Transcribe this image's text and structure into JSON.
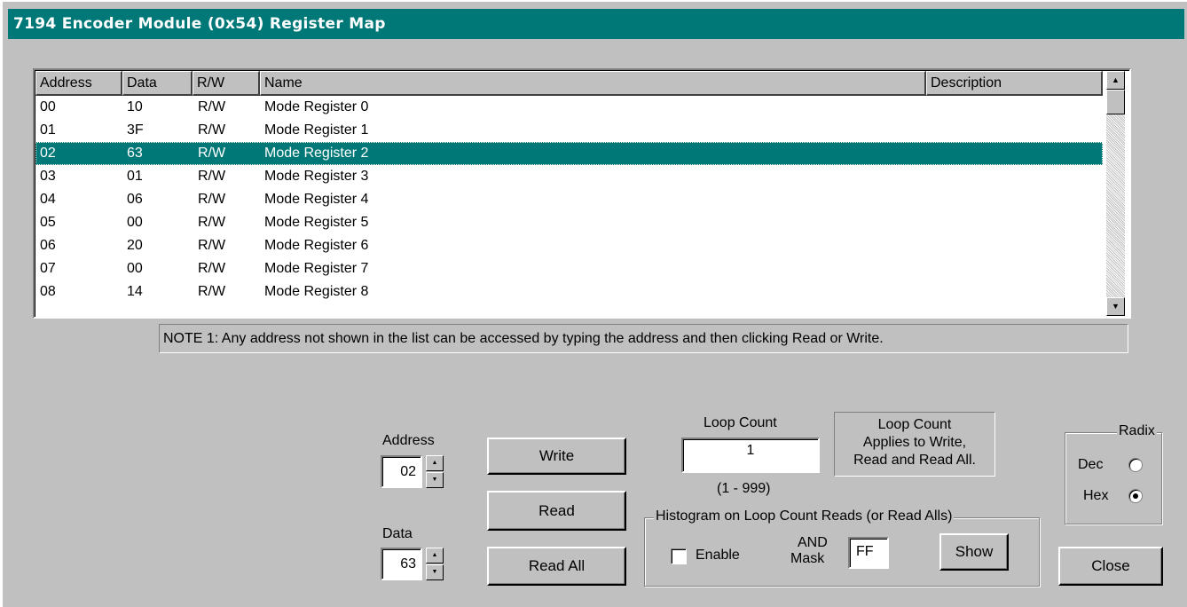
{
  "window": {
    "title": "7194 Encoder Module (0x54) Register Map"
  },
  "list": {
    "columns": [
      "Address",
      "Data",
      "R/W",
      "Name",
      "Description"
    ],
    "selected_index": 2,
    "rows": [
      {
        "address": "00",
        "data": "10",
        "rw": "R/W",
        "name": "Mode Register 0",
        "description": ""
      },
      {
        "address": "01",
        "data": "3F",
        "rw": "R/W",
        "name": "Mode Register 1",
        "description": ""
      },
      {
        "address": "02",
        "data": "63",
        "rw": "R/W",
        "name": "Mode Register 2",
        "description": ""
      },
      {
        "address": "03",
        "data": "01",
        "rw": "R/W",
        "name": "Mode Register 3",
        "description": ""
      },
      {
        "address": "04",
        "data": "06",
        "rw": "R/W",
        "name": "Mode Register 4",
        "description": ""
      },
      {
        "address": "05",
        "data": "00",
        "rw": "R/W",
        "name": "Mode Register 5",
        "description": ""
      },
      {
        "address": "06",
        "data": "20",
        "rw": "R/W",
        "name": "Mode Register 6",
        "description": ""
      },
      {
        "address": "07",
        "data": "00",
        "rw": "R/W",
        "name": "Mode Register 7",
        "description": ""
      },
      {
        "address": "08",
        "data": "14",
        "rw": "R/W",
        "name": "Mode Register 8",
        "description": ""
      }
    ]
  },
  "note": "NOTE 1: Any address not shown in the list can be accessed by typing the address and then clicking Read or Write.",
  "address": {
    "label": "Address",
    "value": "02"
  },
  "data": {
    "label": "Data",
    "value": "63"
  },
  "buttons": {
    "write": "Write",
    "read": "Read",
    "read_all": "Read All",
    "show": "Show",
    "close": "Close"
  },
  "loop": {
    "label": "Loop Count",
    "value": "1",
    "range": "(1 - 999)",
    "info_lines": [
      "Loop Count",
      "Applies to Write,",
      "Read and Read All."
    ]
  },
  "histogram": {
    "title": "Histogram on Loop Count Reads (or Read Alls)",
    "enable_label": "Enable",
    "enable_checked": false,
    "mask_label_1": "AND",
    "mask_label_2": "Mask",
    "mask_value": "FF"
  },
  "radix": {
    "title": "Radix",
    "options": [
      {
        "label": "Dec",
        "selected": false
      },
      {
        "label": "Hex",
        "selected": true
      }
    ]
  },
  "icons": {
    "scroll_up": "scroll-up-arrow-icon",
    "scroll_down": "scroll-down-arrow-icon",
    "spin_up": "spin-up-icon",
    "spin_down": "spin-down-icon"
  }
}
